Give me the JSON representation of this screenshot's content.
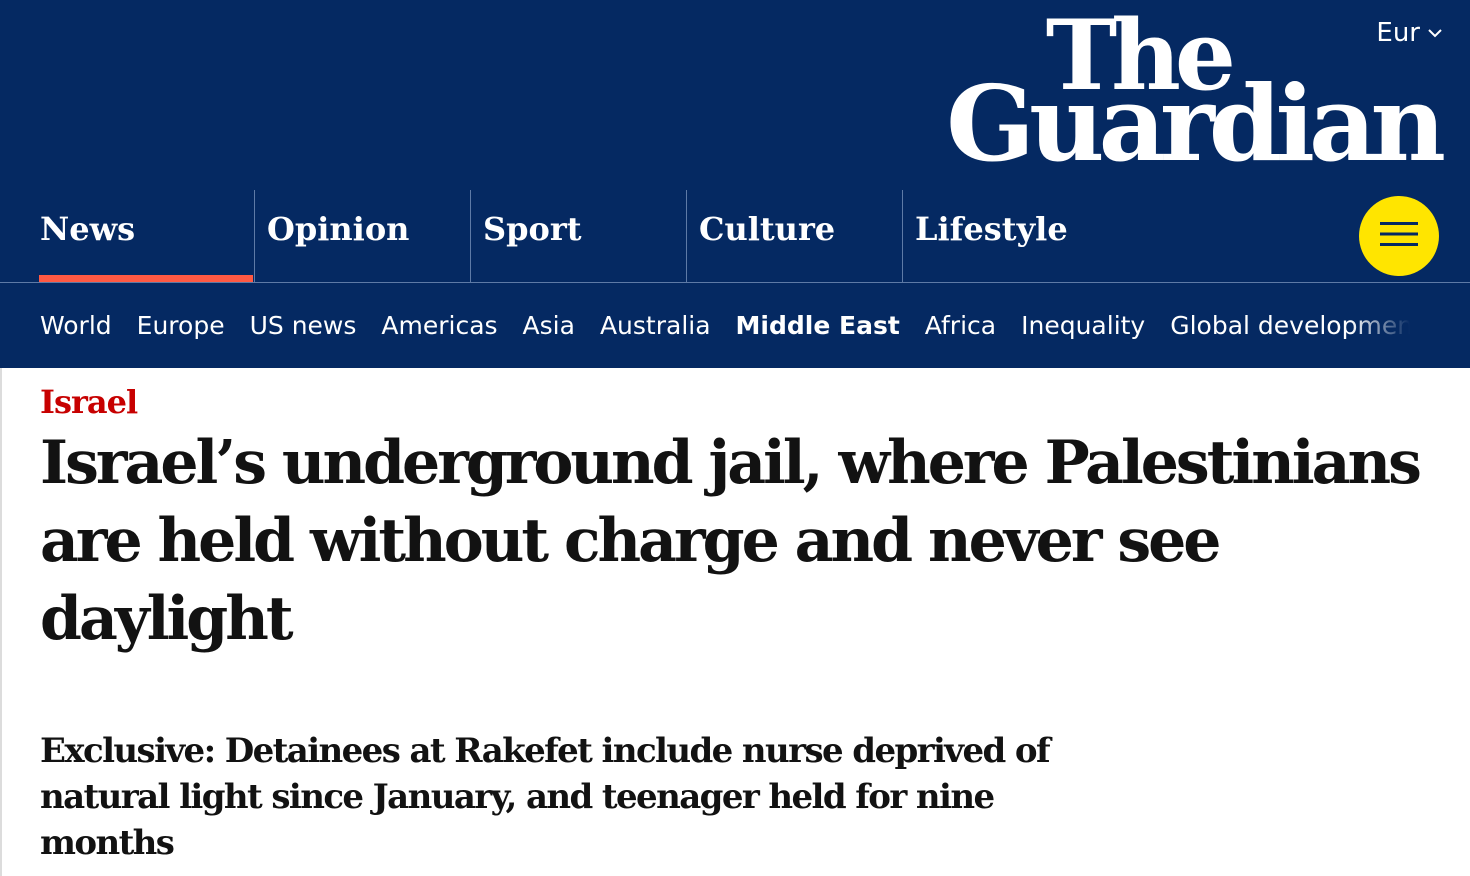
{
  "header": {
    "edition_label": "Eur",
    "logo": {
      "line1": "The",
      "line2": "Guardian"
    }
  },
  "pillars": [
    {
      "label": "News",
      "active": true
    },
    {
      "label": "Opinion"
    },
    {
      "label": "Sport"
    },
    {
      "label": "Culture"
    },
    {
      "label": "Lifestyle"
    }
  ],
  "subnav": [
    {
      "label": "World"
    },
    {
      "label": "Europe"
    },
    {
      "label": "US news"
    },
    {
      "label": "Americas"
    },
    {
      "label": "Asia"
    },
    {
      "label": "Australia"
    },
    {
      "label": "Middle East",
      "active": true
    },
    {
      "label": "Africa"
    },
    {
      "label": "Inequality"
    },
    {
      "label": "Global development"
    }
  ],
  "article": {
    "kicker": "Israel",
    "headline": "Israel’s underground jail, where Palestinians are held without charge and never see daylight",
    "standfirst": "Exclusive: Detainees at Rakefet include nurse deprived of natural light since January, and teenager held for nine months"
  },
  "colors": {
    "brand_blue": "#052962",
    "news_red": "#c70000",
    "active_underline": "#ff5943",
    "menu_yellow": "#ffe500"
  },
  "icons": {
    "edition_chevron": "chevron-down-icon",
    "menu": "hamburger-menu-icon"
  }
}
